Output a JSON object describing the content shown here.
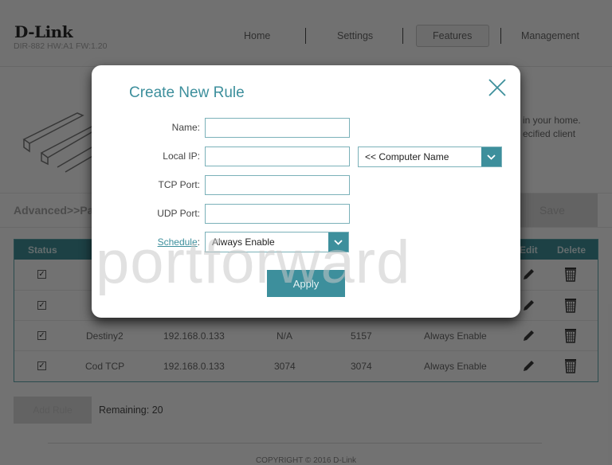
{
  "header": {
    "brand": "D-Link",
    "model": "DIR-882 HW:A1 FW:1.20",
    "nav": [
      {
        "label": "Home",
        "active": false
      },
      {
        "label": "Settings",
        "active": false
      },
      {
        "label": "Features",
        "active": true
      },
      {
        "label": "Management",
        "active": false
      }
    ]
  },
  "intro": {
    "line1": "in your home.",
    "line2": "ecified client"
  },
  "subheader": {
    "breadcrumb": "Advanced>>Pa",
    "save_label": "Save"
  },
  "table": {
    "columns": [
      "Status",
      "Edit",
      "Delete"
    ],
    "rows": [
      {
        "checked": true,
        "name": "",
        "ip": "",
        "tcp": "",
        "udp": "",
        "schedule": ""
      },
      {
        "checked": true,
        "name": "",
        "ip": "",
        "tcp": "",
        "udp": "",
        "schedule": ""
      },
      {
        "checked": true,
        "name": "Destiny2",
        "ip": "192.168.0.133",
        "tcp": "N/A",
        "udp": "5157",
        "schedule": "Always Enable"
      },
      {
        "checked": true,
        "name": "Cod TCP",
        "ip": "192.168.0.133",
        "tcp": "3074",
        "udp": "3074",
        "schedule": "Always Enable"
      }
    ]
  },
  "footer": {
    "add_rule_label": "Add Rule",
    "remaining": "Remaining: 20",
    "copyright": "COPYRIGHT © 2016 D-Link"
  },
  "modal": {
    "title": "Create New Rule",
    "fields": {
      "name_label": "Name:",
      "name_value": "",
      "local_ip_label": "Local IP:",
      "local_ip_value": "",
      "computer_name_select": "<< Computer Name",
      "tcp_label": "TCP Port:",
      "tcp_value": "",
      "udp_label": "UDP Port:",
      "udp_value": "",
      "schedule_label": "Schedule",
      "schedule_colon": ":",
      "schedule_value": "Always Enable"
    },
    "apply_label": "Apply"
  },
  "watermark": "portforward",
  "colors": {
    "accent": "#3d8f9c",
    "table_header": "#2a7f88"
  }
}
